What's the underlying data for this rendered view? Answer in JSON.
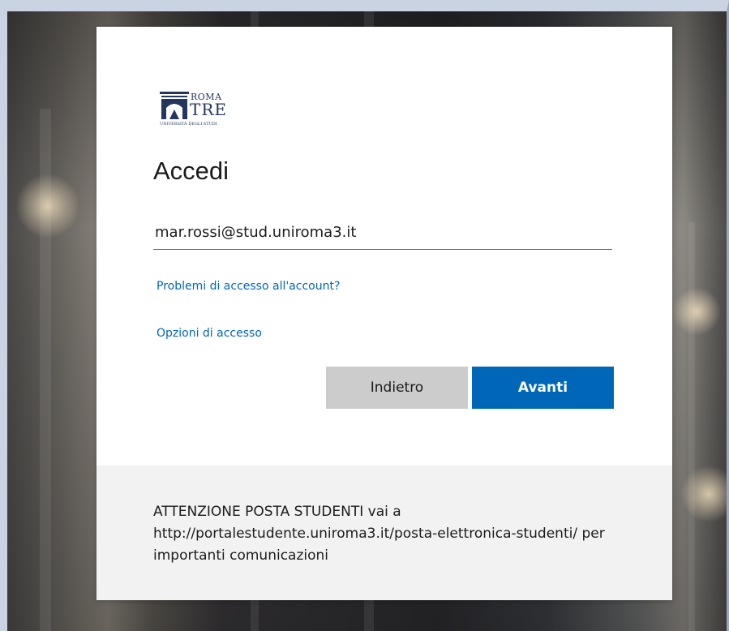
{
  "logo": {
    "line1": "ROMA",
    "line2": "TRE",
    "subtitle": "UNIVERSITÀ DEGLI STUDI",
    "color": "#23365e"
  },
  "signin": {
    "title": "Accedi",
    "email_value": "mar.rossi@stud.uniroma3.it",
    "problems_link": "Problemi di accesso all'account?",
    "options_link": "Opzioni di accesso",
    "back_label": "Indietro",
    "next_label": "Avanti"
  },
  "notice": {
    "text": "ATTENZIONE POSTA STUDENTI vai a http://portalestudente.uniroma3.it/posta-elettronica-studenti/ per importanti comunicazioni"
  },
  "colors": {
    "accent": "#0067b8",
    "secondary_button": "#cccccc",
    "footer_bg": "#f2f2f2"
  }
}
